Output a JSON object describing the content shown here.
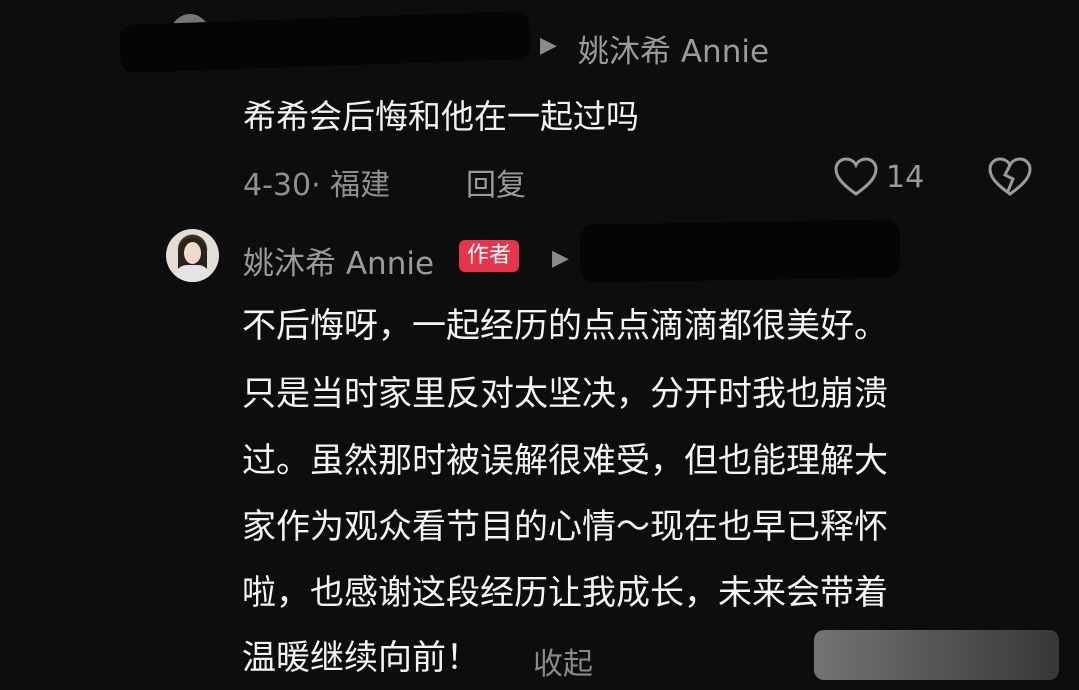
{
  "comment": {
    "reply_to_arrow": "▶",
    "reply_to_name": "姚沐希 Annie",
    "text": "希希会后悔和他在一起过吗",
    "date_location": "4-30· 福建",
    "reply_label": "回复",
    "like_count": "14"
  },
  "reply": {
    "author_name": "姚沐希 Annie",
    "author_badge": "作者",
    "arrow": "▶",
    "lines": [
      "不后悔呀，一起经历的点点滴滴都很美好。",
      "只是当时家里反对太坚决，分开时我也崩溃",
      "过。虽然那时被误解很难受，但也能理解大",
      "家作为观众看节目的心情～现在也早已释怀",
      "啦，也感谢这段经历让我成长，未来会带着",
      "温暖继续向前！"
    ],
    "collapse_label": "收起"
  },
  "colors": {
    "background": "#0d0d0d",
    "badge": "#e8344a",
    "muted": "#8f8f8f"
  }
}
